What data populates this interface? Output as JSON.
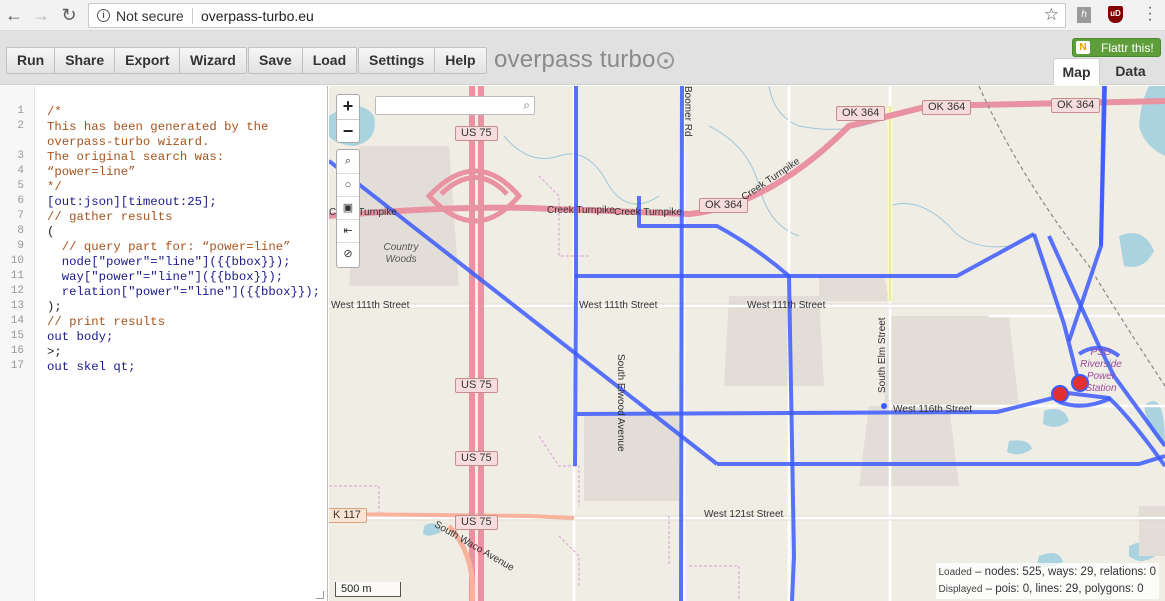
{
  "browser": {
    "security_text": "Not secure",
    "url": "overpass-turbo.eu"
  },
  "toolbar": {
    "group1": [
      "Run",
      "Share",
      "Export"
    ],
    "group2": [
      "Wizard"
    ],
    "group3": [
      "Save",
      "Load"
    ],
    "group4": [
      "Settings",
      "Help"
    ],
    "brand": "overpass turbo",
    "flattr": "Flattr this!",
    "tabs": [
      "Map",
      "Data"
    ]
  },
  "editor": {
    "lines": [
      {
        "n": "1",
        "t": "/*"
      },
      {
        "n": "2",
        "t": "This has been generated by the"
      },
      {
        "n": "",
        "t": "overpass-turbo wizard."
      },
      {
        "n": "3",
        "t": "The original search was:"
      },
      {
        "n": "4",
        "t": "“power=line”"
      },
      {
        "n": "5",
        "t": "*/"
      },
      {
        "n": "6",
        "t": "[out:json][timeout:25];"
      },
      {
        "n": "7",
        "t": "// gather results"
      },
      {
        "n": "8",
        "t": "("
      },
      {
        "n": "9",
        "t": "  // query part for: “power=line”"
      },
      {
        "n": "10",
        "t": "  node[\"power\"=\"line\"]({{bbox}});"
      },
      {
        "n": "11",
        "t": "  way[\"power\"=\"line\"]({{bbox}});"
      },
      {
        "n": "12",
        "t": "  relation[\"power\"=\"line\"]({{bbox}});"
      },
      {
        "n": "13",
        "t": ");"
      },
      {
        "n": "14",
        "t": "// print results"
      },
      {
        "n": "15",
        "t": "out body;"
      },
      {
        "n": "16",
        "t": ">;"
      },
      {
        "n": "17",
        "t": "out skel qt;"
      }
    ]
  },
  "map": {
    "zoom_in": "+",
    "zoom_out": "−",
    "scale": "500 m",
    "labels": {
      "us75_1": "US 75",
      "us75_2": "US 75",
      "us75_3": "US 75",
      "us75_4": "US 75",
      "ok364_1": "OK 364",
      "ok364_2": "OK 364",
      "ok364_3": "OK 364",
      "ok364_4": "OK 364",
      "k117": "K 117",
      "creek_turnpike_1": "Creek Turnpike",
      "creek_turnpike_2": "Creek Turnpike",
      "creek_turnpike_3": "Creek Turnpike",
      "creek_turnpike_4": "Creek Turnpike",
      "w111_1": "West 111th Street",
      "w111_2": "West 111th Street",
      "w111_3": "West 111th Street",
      "w116": "West 116th Street",
      "w121": "West 121st Street",
      "country_woods": "Country Woods",
      "s_elwood": "South Elwood Avenue",
      "s_elm": "South Elm Street",
      "s_waco": "South Waco Avenue",
      "boomer": "Boomer Rd",
      "station": "PSO Riverside Power Station"
    },
    "stats": {
      "loaded_label": "Loaded",
      "loaded_text": "– nodes: 525, ways: 29, relations: 0",
      "displayed_label": "Displayed",
      "displayed_text": "– pois: 0, lines: 29, polygons: 0"
    }
  },
  "colors": {
    "power_line": "#3c5aff",
    "highway": "#e892a2",
    "trunk": "#f9b29c",
    "land": "#f0ede5"
  }
}
